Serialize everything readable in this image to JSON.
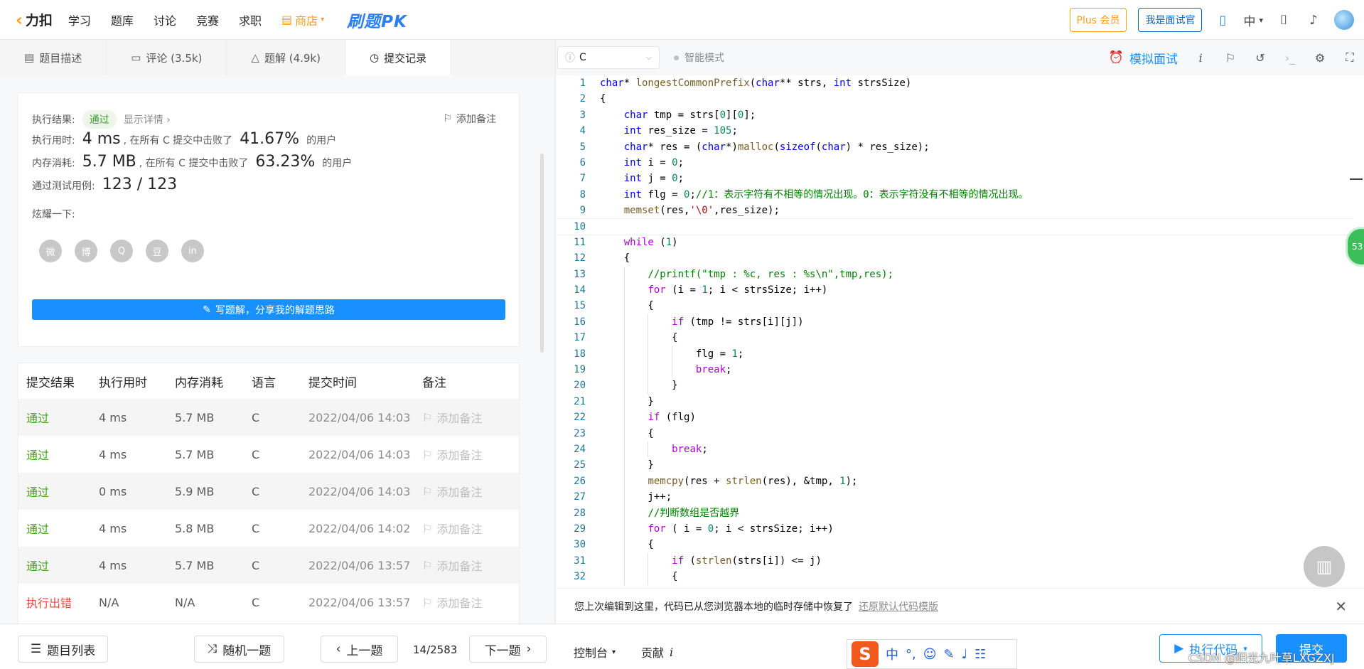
{
  "nav": {
    "logo_text": "力扣",
    "items": [
      "学习",
      "题库",
      "讨论",
      "竞赛",
      "求职"
    ],
    "shop": "商店",
    "pk": "刷题PK",
    "plus": "Plus 会员",
    "interviewer": "我是面试官",
    "lang": "中"
  },
  "tabs": [
    {
      "label": "题目描述",
      "icon": "description-icon"
    },
    {
      "label": "评论 (3.5k)",
      "icon": "comment-icon"
    },
    {
      "label": "题解 (4.9k)",
      "icon": "flask-icon"
    },
    {
      "label": "提交记录",
      "icon": "clock-icon"
    }
  ],
  "result": {
    "label_result": "执行结果:",
    "status": "通过",
    "detail": "显示详情",
    "add_note": "添加备注",
    "label_time": "执行用时:",
    "time": "4 ms",
    "time_mid": ", 在所有 C 提交中击败了",
    "time_pct": "41.67%",
    "users": "的用户",
    "label_mem": "内存消耗:",
    "mem": "5.7 MB",
    "mem_mid": ", 在所有 C 提交中击败了",
    "mem_pct": "63.23%",
    "label_cases": "通过测试用例:",
    "cases": "123 / 123",
    "share_label": "炫耀一下:",
    "share_icons": [
      "wechat-icon",
      "weibo-icon",
      "qq-icon",
      "douban-icon",
      "linkedin-icon"
    ],
    "share_glyphs": [
      "微",
      "博",
      "Q",
      "豆",
      "in"
    ],
    "write_btn": "写题解，分享我的解题思路"
  },
  "submissions": {
    "headers": [
      "提交结果",
      "执行用时",
      "内存消耗",
      "语言",
      "提交时间",
      "备注"
    ],
    "rows": [
      {
        "status": "通过",
        "time": "4 ms",
        "mem": "5.7 MB",
        "lang": "C",
        "date": "2022/04/06 14:03",
        "note": "添加备注"
      },
      {
        "status": "通过",
        "time": "4 ms",
        "mem": "5.7 MB",
        "lang": "C",
        "date": "2022/04/06 14:03",
        "note": "添加备注"
      },
      {
        "status": "通过",
        "time": "0 ms",
        "mem": "5.9 MB",
        "lang": "C",
        "date": "2022/04/06 14:03",
        "note": "添加备注"
      },
      {
        "status": "通过",
        "time": "4 ms",
        "mem": "5.8 MB",
        "lang": "C",
        "date": "2022/04/06 14:02",
        "note": "添加备注"
      },
      {
        "status": "通过",
        "time": "4 ms",
        "mem": "5.7 MB",
        "lang": "C",
        "date": "2022/04/06 13:57",
        "note": "添加备注"
      },
      {
        "status": "执行出错",
        "time": "N/A",
        "mem": "N/A",
        "lang": "C",
        "date": "2022/04/06 13:57",
        "note": "添加备注"
      }
    ]
  },
  "editor": {
    "language": "C",
    "smart_mode": "智能模式",
    "mock_interview": "模拟面试",
    "badge": "53",
    "lines": [
      "<span class=\"kw\">char</span>* <span class=\"fn\">longestCommonPrefix</span>(<span class=\"kw\">char</span>** strs, <span class=\"kw\">int</span> strsSize)",
      "{",
      "    <span class=\"kw\">char</span> tmp = strs[<span class=\"nm\">0</span>][<span class=\"nm\">0</span>];",
      "    <span class=\"kw\">int</span> res_size = <span class=\"nm\">105</span>;",
      "    <span class=\"kw\">char</span>* res = (<span class=\"kw\">char</span>*)<span class=\"fn\">malloc</span>(<span class=\"kw\">sizeof</span>(<span class=\"kw\">char</span>) * res_size);",
      "    <span class=\"kw\">int</span> i = <span class=\"nm\">0</span>;",
      "    <span class=\"kw\">int</span> j = <span class=\"nm\">0</span>;",
      "    <span class=\"kw\">int</span> flg = <span class=\"nm\">0</span>;<span class=\"cm\">//1：表示字符有不相等的情况出现。0：表示字符没有不相等的情况出现。</span>",
      "    <span class=\"fn\">memset</span>(res,<span class=\"st\">'\\0'</span>,res_size);",
      "",
      "    <span class=\"ctl\">while</span> (<span class=\"nm\">1</span>)",
      "    {",
      "        <span class=\"cm\">//printf(\"tmp : %c, res : %s\\n\",tmp,res);</span>",
      "        <span class=\"ctl\">for</span> (i = <span class=\"nm\">1</span>; i &lt; strsSize; i++)",
      "        {",
      "            <span class=\"ctl\">if</span> (tmp != strs[i][j])",
      "            {",
      "                flg = <span class=\"nm\">1</span>;",
      "                <span class=\"ctl\">break</span>;",
      "            }",
      "        }",
      "        <span class=\"ctl\">if</span> (flg)",
      "        {",
      "            <span class=\"ctl\">break</span>;",
      "        }",
      "        <span class=\"fn\">memcpy</span>(res + <span class=\"fn\">strlen</span>(res), &amp;tmp, <span class=\"nm\">1</span>);",
      "        j++;",
      "        <span class=\"cm\">//判断数组是否越界</span>",
      "        <span class=\"ctl\">for</span> ( i = <span class=\"nm\">0</span>; i &lt; strsSize; i++)",
      "        {",
      "            <span class=\"ctl\">if</span> (<span class=\"fn\">strlen</span>(strs[i]) &lt;= j)",
      "            {"
    ],
    "current_line": 10
  },
  "restore": {
    "message": "您上次编辑到这里，代码已从您浏览器本地的临时存储中恢复了",
    "link": "还原默认代码模版"
  },
  "bottom": {
    "problem_list": "题目列表",
    "random": "随机一题",
    "prev": "上一题",
    "page": "14/2583",
    "next": "下一题",
    "console": "控制台",
    "contribute": "贡献",
    "run": "执行代码",
    "submit": "提交",
    "watermark": "CSDN @阳光九叶草LXGZXJ"
  }
}
